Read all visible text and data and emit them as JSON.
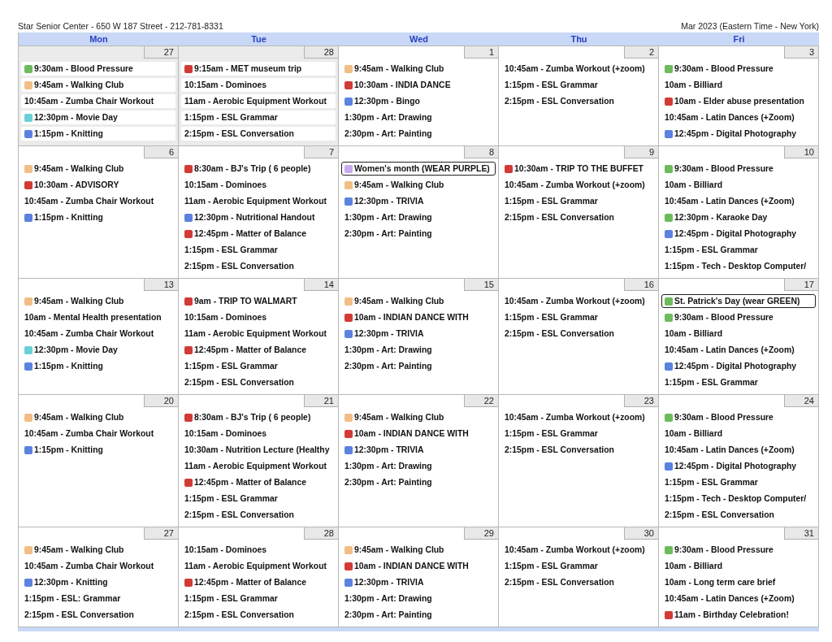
{
  "header": {
    "title": "Star Senior Center - 650 W 187 Street - 212-781-8331",
    "period": "Mar 2023 (Eastern Time - New York)"
  },
  "weekdays": [
    "Mon",
    "Tue",
    "Wed",
    "Thu",
    "Fri"
  ],
  "weeks": [
    [
      {
        "date": "27",
        "other_month": true,
        "events": [
          {
            "text": "9:30am - Blood Pressure",
            "color": "#6dbb5c"
          },
          {
            "text": "9:45am - Walking Club",
            "color": "#f3be86"
          },
          {
            "text": "10:45am - Zumba Chair Workout"
          },
          {
            "text": "12:30pm - Movie Day",
            "color": "#69d0d6"
          },
          {
            "text": "1:15pm - Knitting",
            "color": "#5b82e0"
          }
        ]
      },
      {
        "date": "28",
        "other_month": true,
        "events": [
          {
            "text": "9:15am - MET museum trip",
            "color": "#d13b35"
          },
          {
            "text": "10:15am - Dominoes"
          },
          {
            "text": "11am - Aerobic Equipment Workout"
          },
          {
            "text": "1:15pm - ESL Grammar"
          },
          {
            "text": "2:15pm - ESL Conversation"
          }
        ]
      },
      {
        "date": "1",
        "other_month": false,
        "events": [
          {
            "text": "9:45am - Walking Club",
            "color": "#f3be86"
          },
          {
            "text": "10:30am - INDIA DANCE",
            "color": "#d13b35"
          },
          {
            "text": "12:30pm - Bingo",
            "color": "#5b82e0"
          },
          {
            "text": "1:30pm - Art: Drawing"
          },
          {
            "text": "2:30pm - Art: Painting"
          }
        ]
      },
      {
        "date": "2",
        "other_month": false,
        "events": [
          {
            "text": "10:45am - Zumba Workout (+zoom)"
          },
          {
            "text": "1:15pm - ESL Grammar"
          },
          {
            "text": "2:15pm - ESL Conversation"
          }
        ]
      },
      {
        "date": "3",
        "other_month": false,
        "events": [
          {
            "text": "9:30am - Blood Pressure",
            "color": "#6dbb5c"
          },
          {
            "text": "10am - Billiard"
          },
          {
            "text": "10am - Elder abuse presentation",
            "color": "#d13b35"
          },
          {
            "text": "10:45am - Latin Dances (+Zoom)"
          },
          {
            "text": "12:45pm - Digital Photography",
            "color": "#5b82e0"
          }
        ]
      }
    ],
    [
      {
        "date": "6",
        "other_month": false,
        "events": [
          {
            "text": "9:45am - Walking Club",
            "color": "#f3be86"
          },
          {
            "text": "10:30am - ADVISORY",
            "color": "#d13b35"
          },
          {
            "text": "10:45am - Zumba Chair Workout"
          },
          {
            "text": "1:15pm - Knitting",
            "color": "#5b82e0"
          }
        ]
      },
      {
        "date": "7",
        "other_month": false,
        "events": [
          {
            "text": "8:30am - BJ's Trip ( 6 people)",
            "color": "#d13b35"
          },
          {
            "text": "10:15am - Dominoes"
          },
          {
            "text": "11am - Aerobic Equipment Workout"
          },
          {
            "text": "12:30pm - Nutritional Handout",
            "color": "#5b82e0"
          },
          {
            "text": "12:45pm - Matter of Balance",
            "color": "#d13b35"
          },
          {
            "text": "1:15pm - ESL Grammar"
          },
          {
            "text": "2:15pm - ESL Conversation"
          }
        ]
      },
      {
        "date": "8",
        "other_month": false,
        "events": [
          {
            "text": "Women's month (WEAR PURPLE)",
            "color": "#c9a9f0",
            "all_day": true
          },
          {
            "text": "9:45am - Walking Club",
            "color": "#f3be86"
          },
          {
            "text": "12:30pm - TRIVIA",
            "color": "#5b82e0"
          },
          {
            "text": "1:30pm - Art: Drawing"
          },
          {
            "text": "2:30pm - Art: Painting"
          }
        ]
      },
      {
        "date": "9",
        "other_month": false,
        "events": [
          {
            "text": "10:30am - TRIP TO THE BUFFET",
            "color": "#d13b35"
          },
          {
            "text": "10:45am - Zumba Workout (+zoom)"
          },
          {
            "text": "1:15pm - ESL Grammar"
          },
          {
            "text": "2:15pm - ESL Conversation"
          }
        ]
      },
      {
        "date": "10",
        "other_month": false,
        "events": [
          {
            "text": "9:30am - Blood Pressure",
            "color": "#6dbb5c"
          },
          {
            "text": "10am - Billiard"
          },
          {
            "text": "10:45am - Latin Dances (+Zoom)"
          },
          {
            "text": "12:30pm - Karaoke Day",
            "color": "#6dbb5c"
          },
          {
            "text": "12:45pm - Digital Photography",
            "color": "#5b82e0"
          },
          {
            "text": "1:15pm - ESL Grammar"
          },
          {
            "text": "1:15pm - Tech - Desktop Computer/"
          }
        ]
      }
    ],
    [
      {
        "date": "13",
        "other_month": false,
        "events": [
          {
            "text": "9:45am - Walking Club",
            "color": "#f3be86"
          },
          {
            "text": "10am - Mental Health presentation"
          },
          {
            "text": "10:45am - Zumba Chair Workout"
          },
          {
            "text": "12:30pm - Movie Day",
            "color": "#69d0d6"
          },
          {
            "text": "1:15pm - Knitting",
            "color": "#5b82e0"
          }
        ]
      },
      {
        "date": "14",
        "other_month": false,
        "events": [
          {
            "text": "9am - TRIP TO WALMART",
            "color": "#d13b35"
          },
          {
            "text": "10:15am - Dominoes"
          },
          {
            "text": "11am - Aerobic Equipment Workout"
          },
          {
            "text": "12:45pm - Matter of Balance",
            "color": "#d13b35"
          },
          {
            "text": "1:15pm - ESL Grammar"
          },
          {
            "text": "2:15pm - ESL Conversation"
          }
        ]
      },
      {
        "date": "15",
        "other_month": false,
        "events": [
          {
            "text": "9:45am - Walking Club",
            "color": "#f3be86"
          },
          {
            "text": "10am - INDIAN DANCE WITH",
            "color": "#d13b35"
          },
          {
            "text": "12:30pm - TRIVIA",
            "color": "#5b82e0"
          },
          {
            "text": "1:30pm - Art: Drawing"
          },
          {
            "text": "2:30pm - Art: Painting"
          }
        ]
      },
      {
        "date": "16",
        "other_month": false,
        "events": [
          {
            "text": "10:45am - Zumba Workout (+zoom)"
          },
          {
            "text": "1:15pm - ESL Grammar"
          },
          {
            "text": "2:15pm - ESL Conversation"
          }
        ]
      },
      {
        "date": "17",
        "other_month": false,
        "events": [
          {
            "text": "St. Patrick's Day (wear GREEN)",
            "color": "#6dbb5c",
            "all_day": true
          },
          {
            "text": "9:30am - Blood Pressure",
            "color": "#6dbb5c"
          },
          {
            "text": "10am - Billiard"
          },
          {
            "text": "10:45am - Latin Dances (+Zoom)"
          },
          {
            "text": "12:45pm - Digital Photography",
            "color": "#5b82e0"
          },
          {
            "text": "1:15pm - ESL Grammar"
          }
        ]
      }
    ],
    [
      {
        "date": "20",
        "other_month": false,
        "events": [
          {
            "text": "9:45am - Walking Club",
            "color": "#f3be86"
          },
          {
            "text": "10:45am - Zumba Chair Workout"
          },
          {
            "text": "1:15pm - Knitting",
            "color": "#5b82e0"
          }
        ]
      },
      {
        "date": "21",
        "other_month": false,
        "events": [
          {
            "text": "8:30am - BJ's Trip ( 6 people)",
            "color": "#d13b35"
          },
          {
            "text": "10:15am - Dominoes"
          },
          {
            "text": "10:30am - Nutrition Lecture (Healthy"
          },
          {
            "text": "11am - Aerobic Equipment Workout"
          },
          {
            "text": "12:45pm - Matter of Balance",
            "color": "#d13b35"
          },
          {
            "text": "1:15pm - ESL Grammar"
          },
          {
            "text": "2:15pm - ESL Conversation"
          }
        ]
      },
      {
        "date": "22",
        "other_month": false,
        "events": [
          {
            "text": "9:45am - Walking Club",
            "color": "#f3be86"
          },
          {
            "text": "10am - INDIAN DANCE WITH",
            "color": "#d13b35"
          },
          {
            "text": "12:30pm - TRIVIA",
            "color": "#5b82e0"
          },
          {
            "text": "1:30pm - Art: Drawing"
          },
          {
            "text": "2:30pm - Art: Painting"
          }
        ]
      },
      {
        "date": "23",
        "other_month": false,
        "events": [
          {
            "text": "10:45am - Zumba Workout (+zoom)"
          },
          {
            "text": "1:15pm - ESL Grammar"
          },
          {
            "text": "2:15pm - ESL Conversation"
          }
        ]
      },
      {
        "date": "24",
        "other_month": false,
        "events": [
          {
            "text": "9:30am - Blood Pressure",
            "color": "#6dbb5c"
          },
          {
            "text": "10am - Billiard"
          },
          {
            "text": "10:45am - Latin Dances (+Zoom)"
          },
          {
            "text": "12:45pm - Digital Photography",
            "color": "#5b82e0"
          },
          {
            "text": "1:15pm - ESL Grammar"
          },
          {
            "text": "1:15pm - Tech - Desktop Computer/"
          },
          {
            "text": "2:15pm - ESL Conversation"
          }
        ]
      }
    ],
    [
      {
        "date": "27",
        "other_month": false,
        "events": [
          {
            "text": "9:45am - Walking Club",
            "color": "#f3be86"
          },
          {
            "text": "10:45am - Zumba Chair Workout"
          },
          {
            "text": "12:30pm - Knitting",
            "color": "#5b82e0"
          },
          {
            "text": "1:15pm - ESL: Grammar"
          },
          {
            "text": "2:15pm - ESL Conversation"
          }
        ]
      },
      {
        "date": "28",
        "other_month": false,
        "events": [
          {
            "text": "10:15am - Dominoes"
          },
          {
            "text": "11am - Aerobic Equipment Workout"
          },
          {
            "text": "12:45pm - Matter of Balance",
            "color": "#d13b35"
          },
          {
            "text": "1:15pm - ESL Grammar"
          },
          {
            "text": "2:15pm - ESL Conversation"
          }
        ]
      },
      {
        "date": "29",
        "other_month": false,
        "events": [
          {
            "text": "9:45am - Walking Club",
            "color": "#f3be86"
          },
          {
            "text": "10am - INDIAN DANCE WITH",
            "color": "#d13b35"
          },
          {
            "text": "12:30pm - TRIVIA",
            "color": "#5b82e0"
          },
          {
            "text": "1:30pm - Art: Drawing"
          },
          {
            "text": "2:30pm - Art: Painting"
          }
        ]
      },
      {
        "date": "30",
        "other_month": false,
        "events": [
          {
            "text": "10:45am - Zumba Workout (+zoom)"
          },
          {
            "text": "1:15pm - ESL Grammar"
          },
          {
            "text": "2:15pm - ESL Conversation"
          }
        ]
      },
      {
        "date": "31",
        "other_month": false,
        "events": [
          {
            "text": "9:30am - Blood Pressure",
            "color": "#6dbb5c"
          },
          {
            "text": "10am - Billiard"
          },
          {
            "text": "10am - Long term care brief"
          },
          {
            "text": "10:45am - Latin Dances (+Zoom)"
          },
          {
            "text": "11am - Birthday Celebration!",
            "color": "#d13b35"
          }
        ]
      }
    ]
  ]
}
